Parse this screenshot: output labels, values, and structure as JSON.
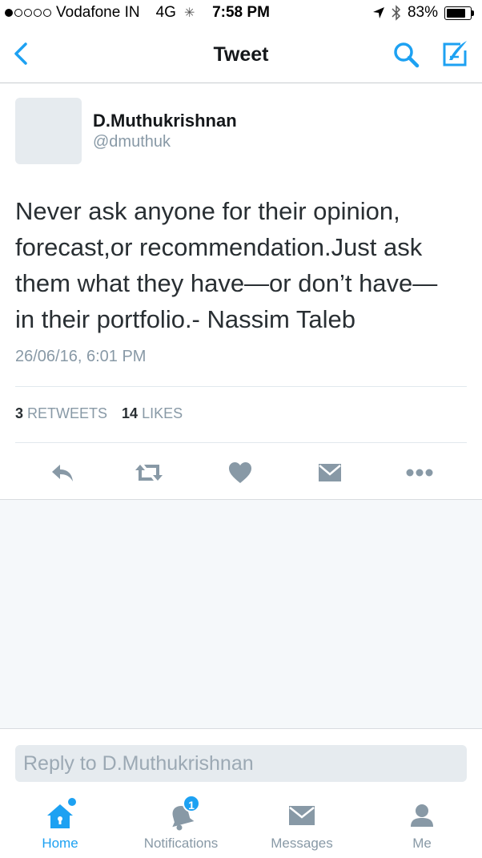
{
  "status_bar": {
    "signal_filled": 1,
    "signal_total": 5,
    "carrier": "Vodafone IN",
    "network": "4G",
    "time": "7:58 PM",
    "battery": "83%",
    "battery_level": 0.83
  },
  "nav": {
    "title": "Tweet",
    "accent_color": "#1da1f2"
  },
  "tweet": {
    "author_name": "D.Muthukrishnan",
    "author_handle": "@dmuthuk",
    "text": "Never ask anyone for their opinion,\nforecast,or recommendation.Just  ask\nthem what they have—or don’t have—\nin their portfolio.- Nassim Taleb",
    "timestamp": "26/06/16, 6:01 PM",
    "retweets_count": "3",
    "retweets_label": "RETWEETS",
    "likes_count": "14",
    "likes_label": "LIKES",
    "actions": [
      {
        "icon": "reply-icon"
      },
      {
        "icon": "retweet-icon"
      },
      {
        "icon": "like-icon"
      },
      {
        "icon": "direct-message-icon"
      },
      {
        "icon": "more-icon"
      }
    ]
  },
  "reply": {
    "placeholder": "Reply to D.Muthukrishnan"
  },
  "tabs": [
    {
      "label": "Home",
      "icon": "home-icon",
      "active": true
    },
    {
      "label": "Notifications",
      "icon": "bell-icon",
      "badge": "1"
    },
    {
      "label": "Messages",
      "icon": "envelope-icon"
    },
    {
      "label": "Me",
      "icon": "person-icon"
    }
  ]
}
